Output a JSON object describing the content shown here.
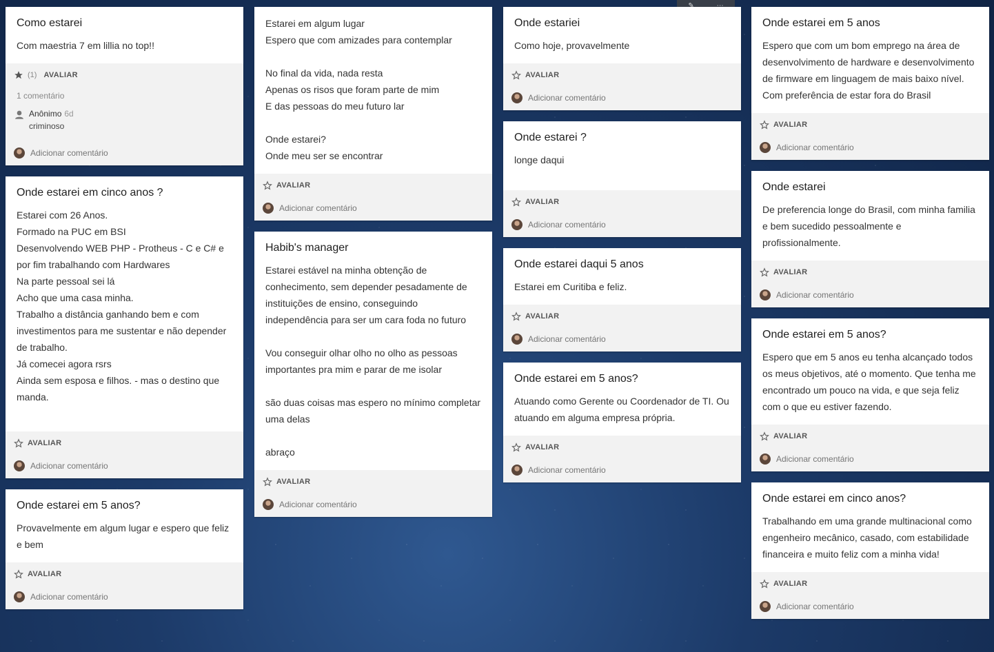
{
  "labels": {
    "rate": "AVALIAR",
    "add_comment": "Adicionar comentário"
  },
  "col1": [
    {
      "title": "Como estarei",
      "text": "Com maestria 7 em lillia no top!!",
      "rating_count": "(1)",
      "comment_count": "1 comentário",
      "comment": {
        "author": "Anônimo",
        "time": "6d",
        "text": "criminoso"
      }
    },
    {
      "title": "Onde estarei em cinco anos ?",
      "text": "Estarei com 26 Anos.\nFormado na PUC em BSI\nDesenvolvendo WEB PHP - Protheus - C e C# e por fim trabalhando com Hardwares\nNa parte pessoal sei lá\nAcho que uma casa minha.\nTrabalho a distância ganhando bem e com investimentos para me sustentar e não depender de trabalho.\nJá comecei agora rsrs\nAinda sem esposa e filhos. - mas o destino que manda."
    },
    {
      "title": "Onde estarei em 5 anos?",
      "text": "Provavelmente em algum lugar e espero que feliz e bem"
    }
  ],
  "col2": [
    {
      "title": "",
      "text": "Estarei em algum lugar\nEspero que com amizades para contemplar\n\nNo final da vida, nada resta\nApenas os risos que foram parte de mim\nE das pessoas do meu futuro lar\n\nOnde estarei?\nOnde meu ser se encontrar"
    },
    {
      "title": "Habib's manager",
      "text": "Estarei estável na minha obtenção de conhecimento, sem depender pesadamente de instituições de ensino, conseguindo independência para ser um cara foda no futuro\n\nVou conseguir olhar olho no olho as pessoas importantes pra mim e parar de me isolar\n\nsão duas coisas mas espero no mínimo completar uma delas\n\nabraço"
    }
  ],
  "col3": [
    {
      "title": "Onde estariei",
      "text": "Como hoje, provavelmente"
    },
    {
      "title": "Onde estarei ?",
      "text": "longe daqui"
    },
    {
      "title": "Onde estarei daqui 5 anos",
      "text": "Estarei em Curitiba e feliz."
    },
    {
      "title": "Onde estarei em 5 anos?",
      "text": "Atuando como Gerente ou Coordenador de TI. Ou atuando em alguma empresa própria."
    }
  ],
  "col4": [
    {
      "title": "Onde estarei em 5 anos",
      "text": "Espero que com um bom emprego na área de desenvolvimento de hardware e desenvolvimento de firmware em linguagem de mais baixo nível. Com preferência de estar fora do Brasil"
    },
    {
      "title": "Onde estarei",
      "text": "De preferencia longe do Brasil, com minha familia e bem sucedido pessoalmente e profissionalmente."
    },
    {
      "title": "Onde estarei em 5 anos?",
      "text": " Espero que em 5 anos eu tenha alcançado todos os meus objetivos, até o momento. Que tenha me encontrado um pouco na vida, e que seja feliz com o que eu estiver fazendo."
    },
    {
      "title": "Onde estarei em cinco anos?",
      "text": "Trabalhando em uma grande multinacional como engenheiro mecânico, casado, com estabilidade financeira e muito feliz com a minha vida!"
    }
  ],
  "icons": {
    "star_empty": "star-outline-icon",
    "star_filled": "star-filled-icon",
    "avatar": "user-avatar"
  }
}
